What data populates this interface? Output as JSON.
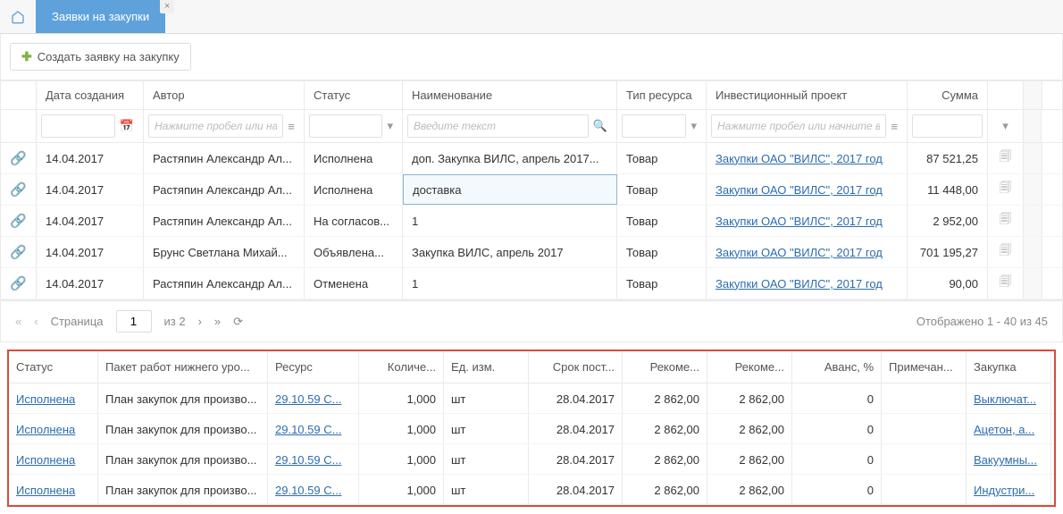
{
  "tabs": {
    "active": "Заявки на закупки"
  },
  "toolbar": {
    "create": "Создать заявку на закупку"
  },
  "mainHeaders": {
    "date": "Дата создания",
    "author": "Автор",
    "status": "Статус",
    "name": "Наименование",
    "type": "Тип ресурса",
    "project": "Инвестиционный проект",
    "sum": "Сумма"
  },
  "filters": {
    "author_ph": "Нажмите пробел или начн",
    "name_ph": "Введите текст",
    "project_ph": "Нажмите пробел или начните ввод"
  },
  "rows": [
    {
      "date": "14.04.2017",
      "author": "Растяпин Александр Ал...",
      "status": "Исполнена",
      "name": "доп. Закупка ВИЛС, апрель 2017...",
      "type": "Товар",
      "project": "Закупки ОАО \"ВИЛС\", 2017 год",
      "sum": "87 521,25"
    },
    {
      "date": "14.04.2017",
      "author": "Растяпин Александр Ал...",
      "status": "Исполнена",
      "name": "доставка",
      "type": "Товар",
      "project": "Закупки ОАО \"ВИЛС\", 2017 год",
      "sum": "11 448,00",
      "highlight": true
    },
    {
      "date": "14.04.2017",
      "author": "Растяпин Александр Ал...",
      "status": "На согласов...",
      "name": "1",
      "type": "Товар",
      "project": "Закупки ОАО \"ВИЛС\", 2017 год",
      "sum": "2 952,00"
    },
    {
      "date": "14.04.2017",
      "author": "Брунс Светлана Михай...",
      "status": "Объявлена...",
      "name": "Закупка ВИЛС, апрель 2017",
      "type": "Товар",
      "project": "Закупки ОАО \"ВИЛС\", 2017 год",
      "sum": "701 195,27"
    },
    {
      "date": "14.04.2017",
      "author": "Растяпин Александр Ал...",
      "status": "Отменена",
      "name": "1",
      "type": "Товар",
      "project": "Закупки ОАО \"ВИЛС\", 2017 год",
      "sum": "90,00"
    }
  ],
  "pager": {
    "label": "Страница",
    "page": "1",
    "of": "из 2",
    "summary": "Отображено 1 - 40 из 45"
  },
  "detailHeaders": {
    "status": "Статус",
    "pack": "Пакет работ нижнего уро...",
    "res": "Ресурс",
    "qty": "Количе...",
    "unit": "Ед. изм.",
    "date": "Срок пост...",
    "rec1": "Рекоме...",
    "rec2": "Рекоме...",
    "avans": "Аванс, %",
    "note": "Примечан...",
    "zak": "Закупка"
  },
  "detailRows": [
    {
      "status": "Исполнена",
      "pack": "План закупок для произво...",
      "res": "29.10.59 С...",
      "qty": "1,000",
      "unit": "шт",
      "date": "28.04.2017",
      "rec1": "2 862,00",
      "rec2": "2 862,00",
      "avans": "0",
      "zak": "Выключат..."
    },
    {
      "status": "Исполнена",
      "pack": "План закупок для произво...",
      "res": "29.10.59 С...",
      "qty": "1,000",
      "unit": "шт",
      "date": "28.04.2017",
      "rec1": "2 862,00",
      "rec2": "2 862,00",
      "avans": "0",
      "zak": "Ацетон, а..."
    },
    {
      "status": "Исполнена",
      "pack": "План закупок для произво...",
      "res": "29.10.59 С...",
      "qty": "1,000",
      "unit": "шт",
      "date": "28.04.2017",
      "rec1": "2 862,00",
      "rec2": "2 862,00",
      "avans": "0",
      "zak": "Вакуумны..."
    },
    {
      "status": "Исполнена",
      "pack": "План закупок для произво...",
      "res": "29.10.59 С...",
      "qty": "1,000",
      "unit": "шт",
      "date": "28.04.2017",
      "rec1": "2 862,00",
      "rec2": "2 862,00",
      "avans": "0",
      "zak": "Индустри..."
    }
  ]
}
